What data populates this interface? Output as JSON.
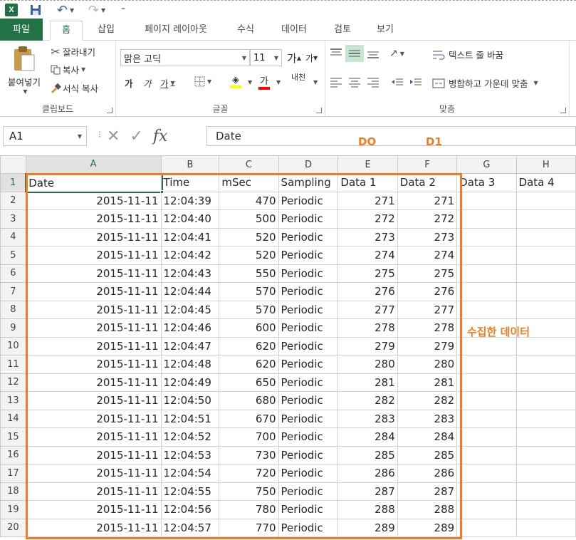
{
  "qat": {
    "app_icon": "X",
    "undo_arrow": "↶",
    "redo_arrow": "↷",
    "customize": "⁼"
  },
  "tabs": [
    "파일",
    "홈",
    "삽입",
    "페이지 레이아웃",
    "수식",
    "데이터",
    "검토",
    "보기"
  ],
  "active_tab": "홈",
  "ribbon": {
    "clipboard": {
      "label": "클립보드",
      "paste": "붙여넣기",
      "cut": "잘라내기",
      "copy": "복사",
      "format_painter": "서식 복사"
    },
    "font": {
      "label": "글꼴",
      "font_name": "맑은 고딕",
      "font_size": "11",
      "grow": "가",
      "shrink": "가",
      "bold": "가",
      "italic": "가",
      "underline": "가",
      "fill_color": "#ffff00",
      "font_color_label": "가",
      "font_color": "#ff0000",
      "phonetic": "내천"
    },
    "alignment": {
      "label": "맞춤",
      "wrap_text": "텍스트 줄 바꿈",
      "merge_center": "병합하고 가운데 맞춤"
    }
  },
  "formula_bar": {
    "name_box": "A1",
    "cancel": "✕",
    "enter": "✓",
    "fx": "fx",
    "content": "Date"
  },
  "columns": [
    "A",
    "B",
    "C",
    "D",
    "E",
    "F",
    "G",
    "H"
  ],
  "header_row": [
    "Date",
    "Time",
    "mSec",
    "Sampling",
    "Data 1",
    "Data 2",
    "Data 3",
    "Data 4"
  ],
  "rows": [
    [
      "2015-11-11",
      "12:04:39",
      "470",
      "Periodic",
      "271",
      "271"
    ],
    [
      "2015-11-11",
      "12:04:40",
      "500",
      "Periodic",
      "272",
      "272"
    ],
    [
      "2015-11-11",
      "12:04:41",
      "520",
      "Periodic",
      "273",
      "273"
    ],
    [
      "2015-11-11",
      "12:04:42",
      "520",
      "Periodic",
      "274",
      "274"
    ],
    [
      "2015-11-11",
      "12:04:43",
      "550",
      "Periodic",
      "275",
      "275"
    ],
    [
      "2015-11-11",
      "12:04:44",
      "570",
      "Periodic",
      "276",
      "276"
    ],
    [
      "2015-11-11",
      "12:04:45",
      "570",
      "Periodic",
      "277",
      "277"
    ],
    [
      "2015-11-11",
      "12:04:46",
      "600",
      "Periodic",
      "278",
      "278"
    ],
    [
      "2015-11-11",
      "12:04:47",
      "620",
      "Periodic",
      "279",
      "279"
    ],
    [
      "2015-11-11",
      "12:04:48",
      "620",
      "Periodic",
      "280",
      "280"
    ],
    [
      "2015-11-11",
      "12:04:49",
      "650",
      "Periodic",
      "281",
      "281"
    ],
    [
      "2015-11-11",
      "12:04:50",
      "680",
      "Periodic",
      "282",
      "282"
    ],
    [
      "2015-11-11",
      "12:04:51",
      "670",
      "Periodic",
      "283",
      "283"
    ],
    [
      "2015-11-11",
      "12:04:52",
      "700",
      "Periodic",
      "284",
      "284"
    ],
    [
      "2015-11-11",
      "12:04:53",
      "730",
      "Periodic",
      "285",
      "285"
    ],
    [
      "2015-11-11",
      "12:04:54",
      "720",
      "Periodic",
      "286",
      "286"
    ],
    [
      "2015-11-11",
      "12:04:55",
      "750",
      "Periodic",
      "287",
      "287"
    ],
    [
      "2015-11-11",
      "12:04:56",
      "780",
      "Periodic",
      "288",
      "288"
    ],
    [
      "2015-11-11",
      "12:04:57",
      "770",
      "Periodic",
      "289",
      "289"
    ]
  ],
  "annotations": {
    "d0": "DO",
    "d1": "D1",
    "collected": "수집한 데이터",
    "color": "#f47b20"
  },
  "colors": {
    "excel_green": "#217346"
  }
}
